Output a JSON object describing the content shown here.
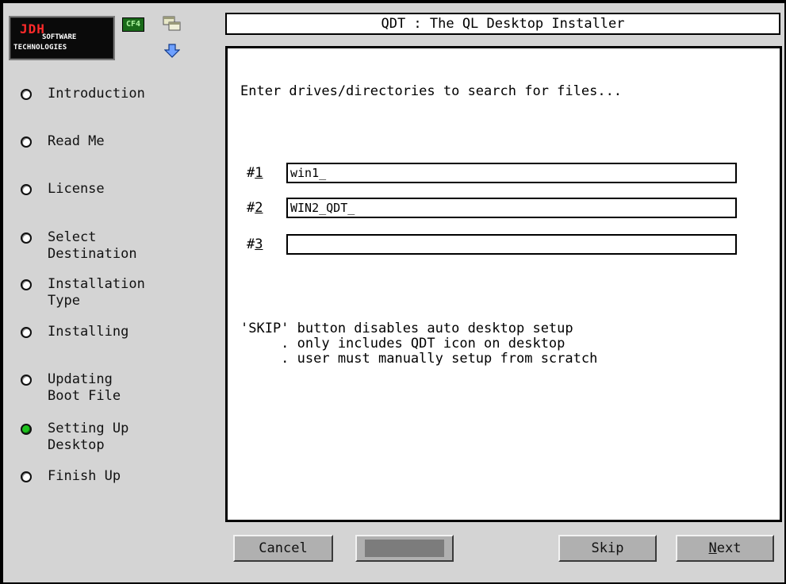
{
  "title": "QDT  :  The QL Desktop Installer",
  "logo": {
    "line1": "JDH",
    "line2": "SOFTWARE",
    "line3": "TECHNOLOGIES"
  },
  "toolbar": {
    "cf4_label": "CF4",
    "icons": [
      "windows-icon",
      "down-arrow-icon"
    ]
  },
  "steps": [
    {
      "label": "Introduction",
      "active": false
    },
    {
      "label": "Read Me",
      "active": false
    },
    {
      "label": "License",
      "active": false
    },
    {
      "label": "Select\nDestination",
      "active": false
    },
    {
      "label": "Installation\nType",
      "active": false
    },
    {
      "label": "Installing",
      "active": false
    },
    {
      "label": "Updating\nBoot File",
      "active": false
    },
    {
      "label": "Setting Up\nDesktop",
      "active": true
    },
    {
      "label": "Finish Up",
      "active": false
    }
  ],
  "main": {
    "prompt": "Enter drives/directories to search for files...",
    "drives": [
      {
        "prefix": "#",
        "num": "1",
        "value": "win1_"
      },
      {
        "prefix": "#",
        "num": "2",
        "value": "WIN2_QDT_"
      },
      {
        "prefix": "#",
        "num": "3",
        "value": ""
      }
    ],
    "skip_note": "'SKIP' button disables auto desktop setup\n     . only includes QDT icon on desktop\n     . user must manually setup from scratch"
  },
  "buttons": {
    "cancel": "Cancel",
    "skip": "Skip",
    "next_first": "N",
    "next_rest": "ext"
  },
  "colors": {
    "active_step": "#1ec21e",
    "background": "#d4d4d4",
    "button": "#b0b0b0"
  }
}
